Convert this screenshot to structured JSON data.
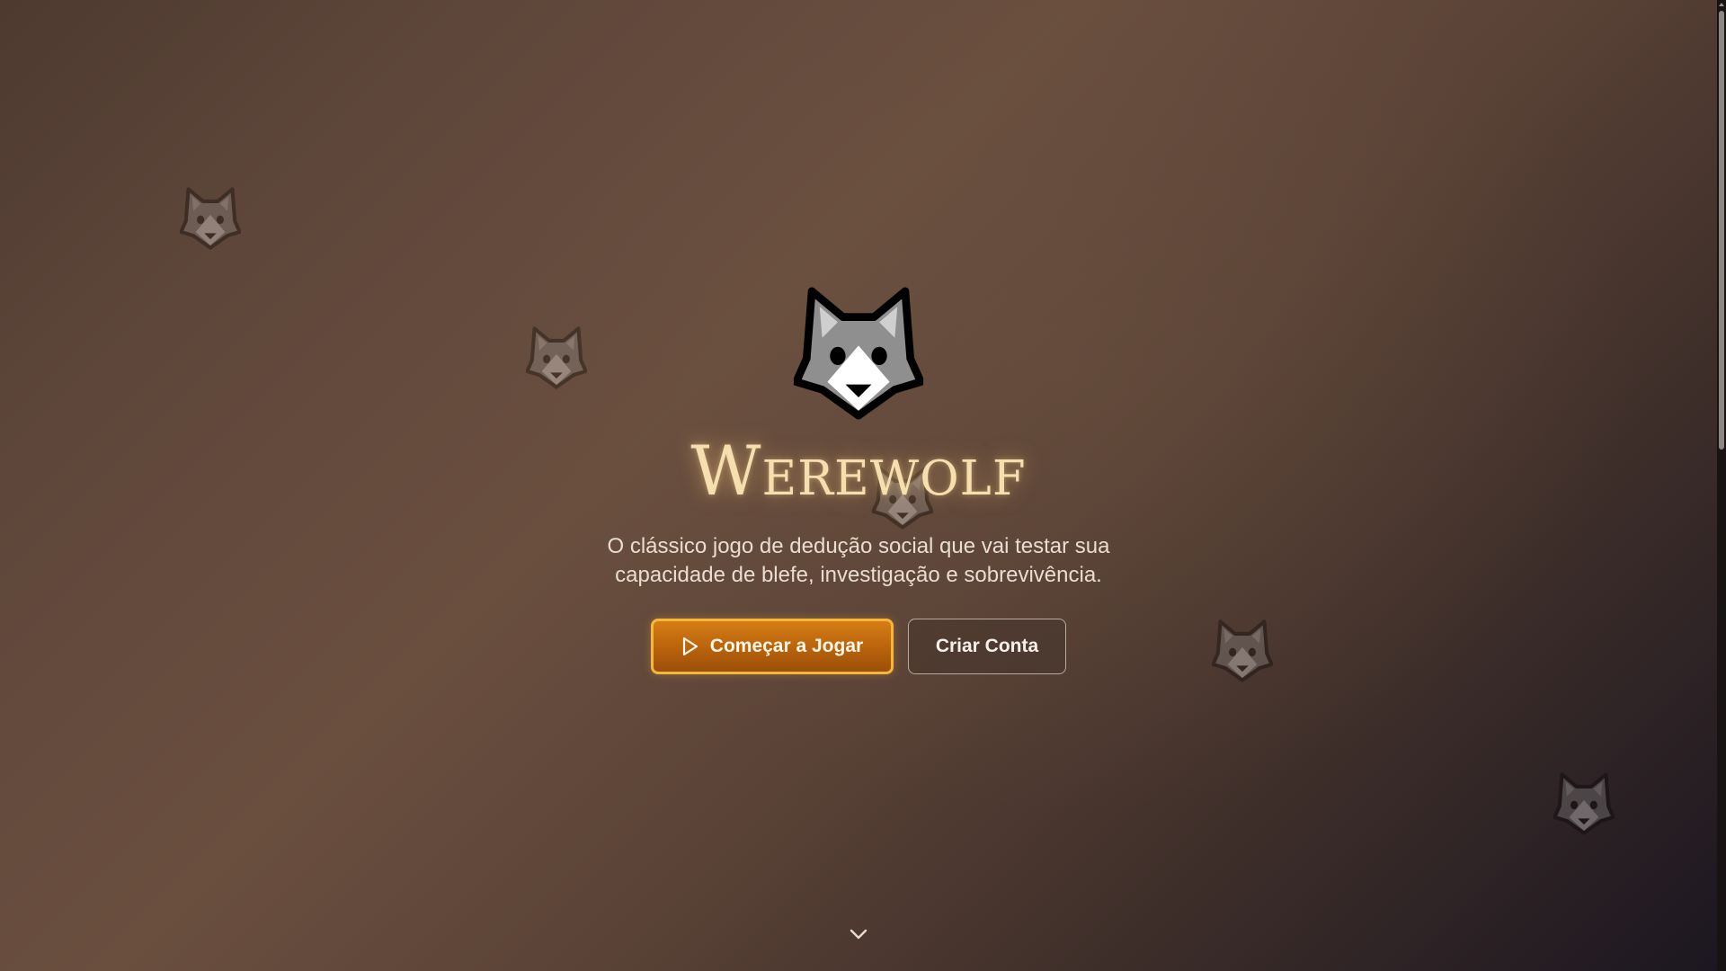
{
  "hero": {
    "logo_icon": "wolf-face-icon",
    "title": "Werewolf",
    "subtitle": "O clássico jogo de dedução social que vai testar sua capacidade de blefe, investigação e sobrevivência."
  },
  "actions": {
    "start_label": "Começar a Jogar",
    "start_icon": "play-icon",
    "create_account_label": "Criar Conta"
  },
  "scroll_hint_icon": "chevron-down-icon",
  "background_icon": "wolf-face-icon",
  "colors": {
    "title_gold": "#f6dfae",
    "primary_button": "#c06a0e",
    "primary_border": "#f4b73a",
    "background_brown": "#5e463a"
  }
}
